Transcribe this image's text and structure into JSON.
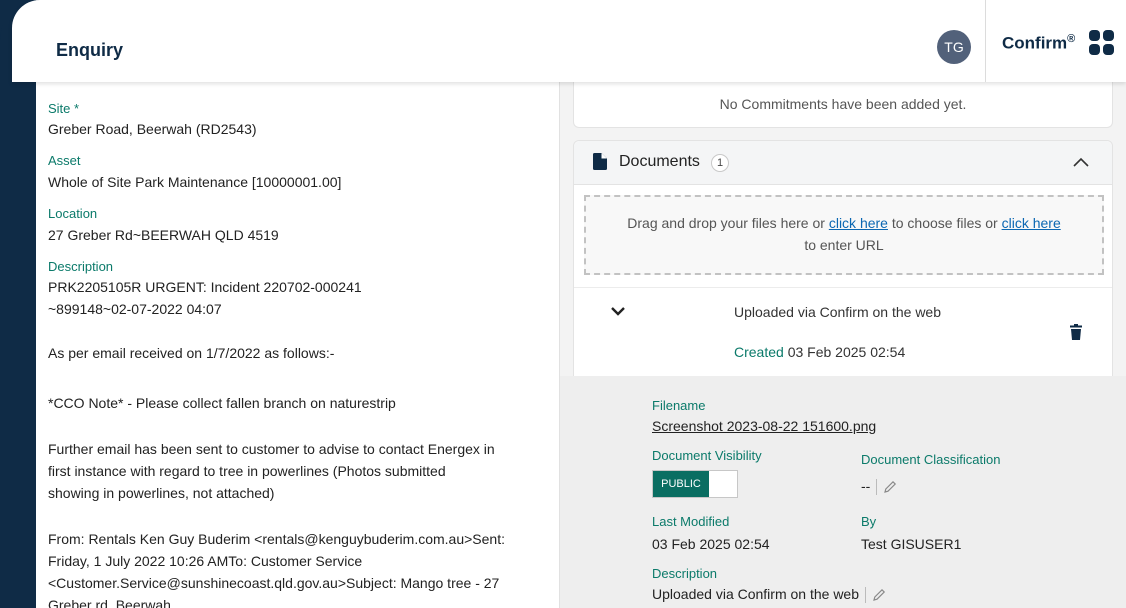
{
  "header": {
    "title": "Enquiry",
    "avatar_initials": "TG",
    "brand_name": "Confirm",
    "brand_mark": "®"
  },
  "enquiry": {
    "site_label": "Site *",
    "site_value": "Greber Road, Beerwah (RD2543)",
    "asset_label": "Asset",
    "asset_value": "Whole of Site Park Maintenance [10000001.00]",
    "location_label": "Location",
    "location_value": "27 Greber Rd~BEERWAH  QLD  4519",
    "description_label": "Description",
    "description_line1": "PRK2205105R URGENT: Incident 220702-000241",
    "description_line2": "~899148~02-07-2022 04:07",
    "para1": "As per email received on 1/7/2022 as follows:-",
    "para2": "*CCO Note* - Please collect fallen branch on naturestrip",
    "para3_line1": "Further email has been sent to customer to advise to contact Energex in",
    "para3_line2": "first instance with regard to tree in powerlines (Photos submitted",
    "para3_line3": "showing in powerlines, not attached)",
    "para4_line1": "From: Rentals Ken Guy Buderim <rentals@kenguybuderim.com.au>Sent:",
    "para4_line2": "Friday, 1 July 2022 10:26 AMTo: Customer Service",
    "para4_line3": "<Customer.Service@sunshinecoast.qld.gov.au>Subject: Mango tree - 27",
    "para4_line4": "Greber rd, Beerwah"
  },
  "commitments": {
    "empty_text": "No Commitments have been added yet."
  },
  "documents": {
    "title": "Documents",
    "count": "1",
    "dropzone_text1": "Drag and drop your files here or ",
    "dropzone_link1": "click here",
    "dropzone_text2": " to choose files or ",
    "dropzone_link2": "click here",
    "dropzone_text3": "to enter URL",
    "item": {
      "name": "Uploaded via Confirm on the web",
      "created_label": "Created",
      "created_value": "03 Feb 2025 02:54"
    },
    "details": {
      "filename_label": "Filename",
      "filename_value": "Screenshot 2023-08-22 151600.png",
      "visibility_label": "Document Visibility",
      "visibility_value": "PUBLIC",
      "classification_label": "Document Classification",
      "classification_value": "--",
      "last_modified_label": "Last Modified",
      "last_modified_value": "03 Feb 2025 02:54",
      "by_label": "By",
      "by_value": "Test GISUSER1",
      "description_label": "Description",
      "description_value": "Uploaded via Confirm on the web"
    }
  },
  "colors": {
    "navy": "#0f2b46",
    "teal": "#0b7a6a",
    "link": "#0b67b2"
  }
}
